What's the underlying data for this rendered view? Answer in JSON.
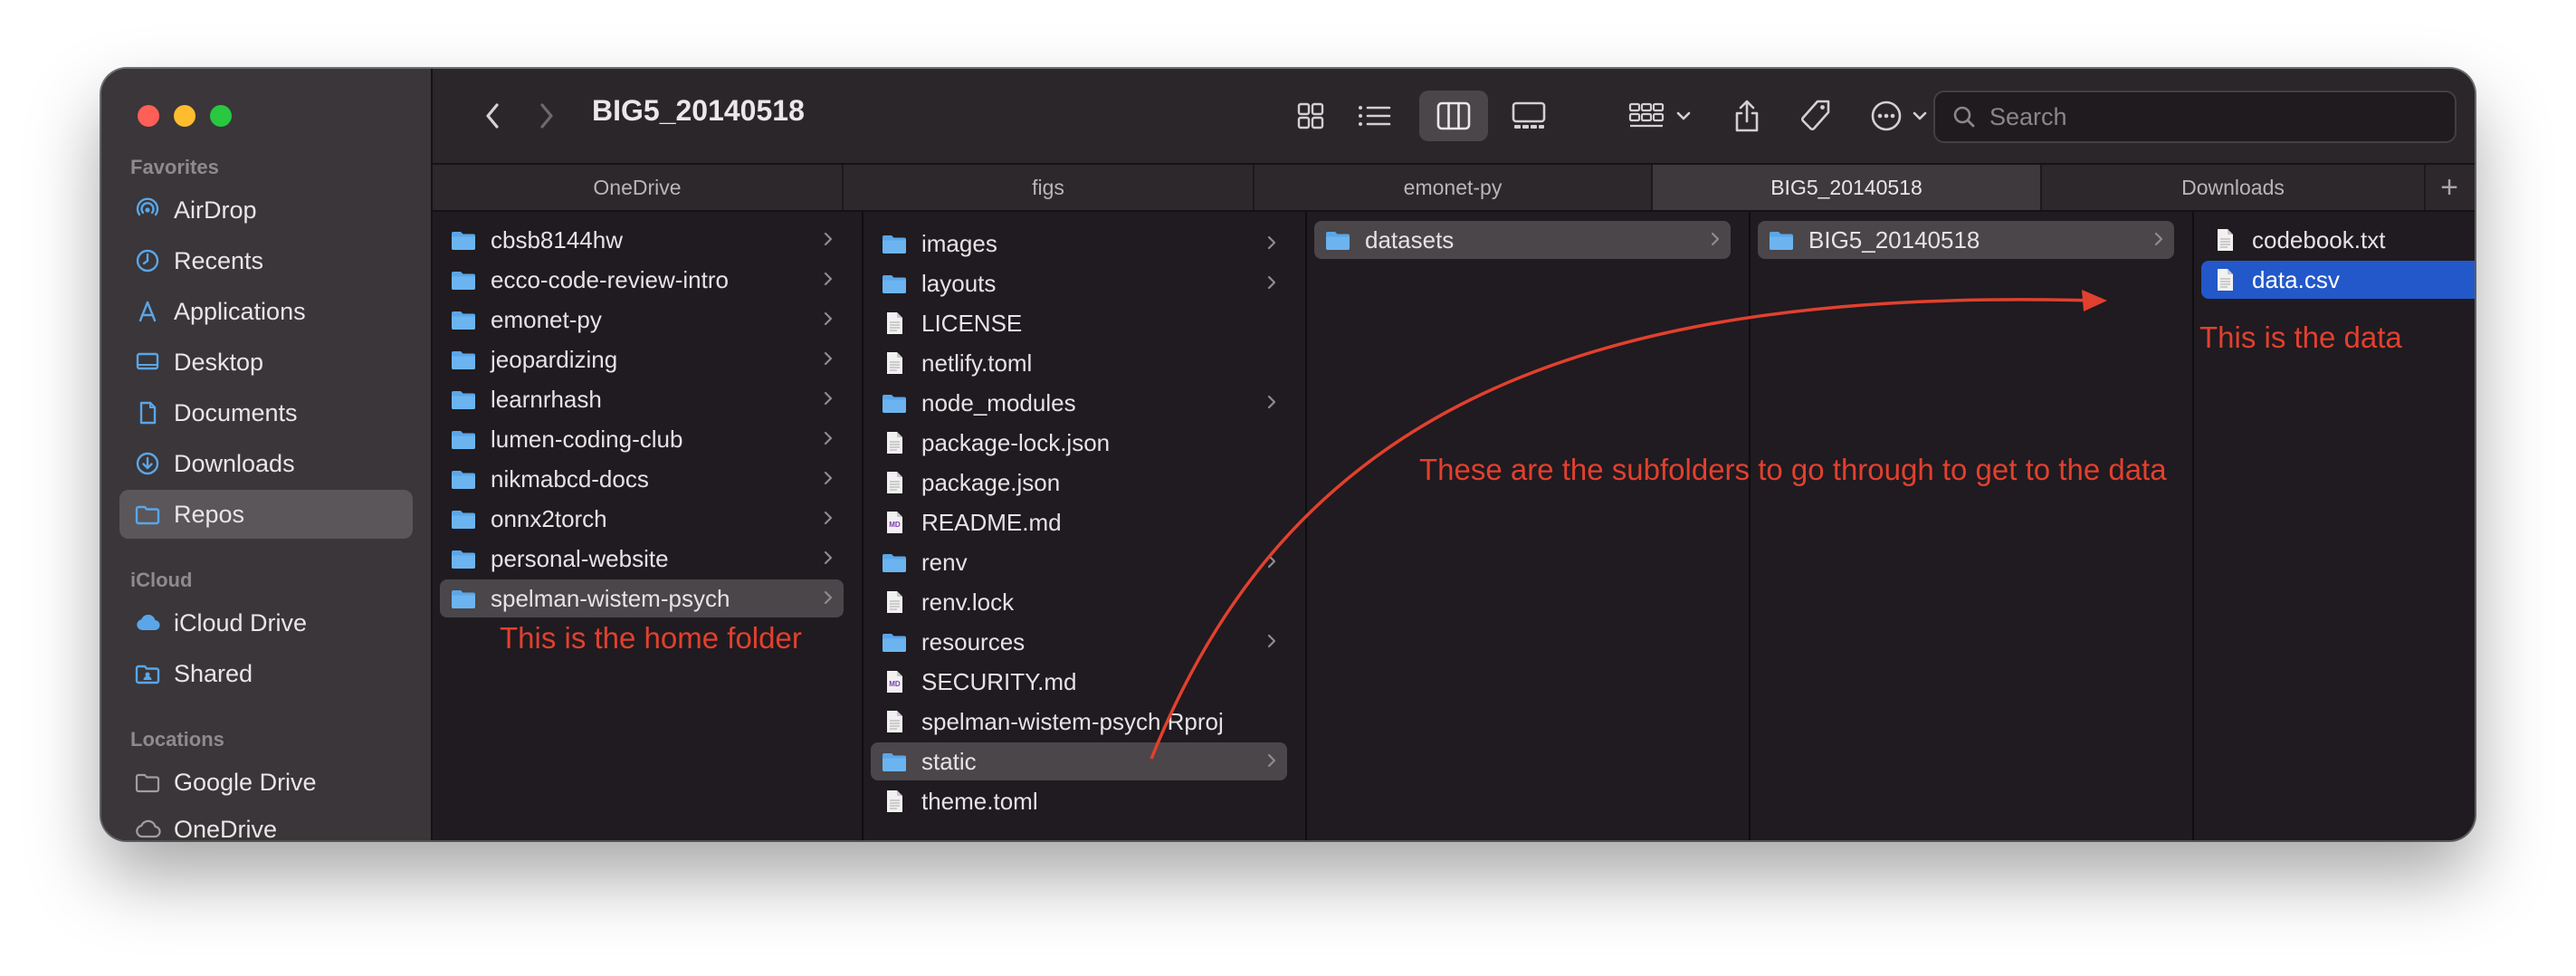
{
  "window": {
    "title": "BIG5_20140518"
  },
  "toolbar": {
    "back_icon": "chevron-left-icon",
    "forward_icon": "chevron-right-icon",
    "view_icons": [
      "grid-view-icon",
      "list-view-icon",
      "column-view-icon",
      "gallery-view-icon"
    ],
    "active_view": "column-view-icon",
    "action_icons": [
      "group-icon",
      "share-icon",
      "tag-icon",
      "more-icon"
    ]
  },
  "search": {
    "placeholder": "Search"
  },
  "sidebar": {
    "favorites_label": "Favorites",
    "favorites": [
      {
        "label": "AirDrop",
        "icon": "airdrop-icon"
      },
      {
        "label": "Recents",
        "icon": "clock-icon"
      },
      {
        "label": "Applications",
        "icon": "applications-icon"
      },
      {
        "label": "Desktop",
        "icon": "desktop-icon"
      },
      {
        "label": "Documents",
        "icon": "document-icon"
      },
      {
        "label": "Downloads",
        "icon": "download-icon"
      },
      {
        "label": "Repos",
        "icon": "folder-icon"
      }
    ],
    "selected": "Repos",
    "icloud_label": "iCloud",
    "icloud": [
      {
        "label": "iCloud Drive",
        "icon": "cloud-icon"
      },
      {
        "label": "Shared",
        "icon": "shared-folder-icon"
      }
    ],
    "locations_label": "Locations",
    "locations": [
      {
        "label": "Google Drive",
        "icon": "folder-outline-icon"
      },
      {
        "label": "OneDrive",
        "icon": "cloud-outline-icon"
      }
    ]
  },
  "tabs": [
    "OneDrive",
    "figs",
    "emonet-py",
    "BIG5_20140518",
    "Downloads"
  ],
  "active_tab": "BIG5_20140518",
  "new_tab_label": "+",
  "columns": {
    "col1": [
      {
        "name": "cbsb8144hw",
        "type": "folder"
      },
      {
        "name": "ecco-code-review-intro",
        "type": "folder"
      },
      {
        "name": "emonet-py",
        "type": "folder"
      },
      {
        "name": "jeopardizing",
        "type": "folder"
      },
      {
        "name": "learnrhash",
        "type": "folder"
      },
      {
        "name": "lumen-coding-club",
        "type": "folder"
      },
      {
        "name": "nikmabcd-docs",
        "type": "folder"
      },
      {
        "name": "onnx2torch",
        "type": "folder"
      },
      {
        "name": "personal-website",
        "type": "folder"
      },
      {
        "name": "spelman-wistem-psych",
        "type": "folder",
        "selected": true
      }
    ],
    "col2": [
      {
        "name": "images",
        "type": "folder"
      },
      {
        "name": "layouts",
        "type": "folder"
      },
      {
        "name": "LICENSE",
        "type": "file"
      },
      {
        "name": "netlify.toml",
        "type": "file"
      },
      {
        "name": "node_modules",
        "type": "folder"
      },
      {
        "name": "package-lock.json",
        "type": "file"
      },
      {
        "name": "package.json",
        "type": "file"
      },
      {
        "name": "README.md",
        "type": "md"
      },
      {
        "name": "renv",
        "type": "folder"
      },
      {
        "name": "renv.lock",
        "type": "file"
      },
      {
        "name": "resources",
        "type": "folder"
      },
      {
        "name": "SECURITY.md",
        "type": "md"
      },
      {
        "name": "spelman-wistem-psych.Rproj",
        "type": "file"
      },
      {
        "name": "static",
        "type": "folder",
        "selected": true
      },
      {
        "name": "theme.toml",
        "type": "file"
      }
    ],
    "col3": [
      {
        "name": "datasets",
        "type": "folder",
        "selected": true
      }
    ],
    "col4": [
      {
        "name": "BIG5_20140518",
        "type": "folder",
        "selected": true
      }
    ],
    "col5": [
      {
        "name": "codebook.txt",
        "type": "file"
      },
      {
        "name": "data.csv",
        "type": "file",
        "selected": true
      }
    ]
  },
  "md_badge": "MD",
  "annotations": {
    "home": "This is the home folder",
    "subfolders": "These are the subfolders to go through to get to the data",
    "data": "This is the data"
  },
  "colors": {
    "folder": "#5aa6e8",
    "selection_blue": "#2258c9",
    "annotation_red": "#e2402e"
  }
}
